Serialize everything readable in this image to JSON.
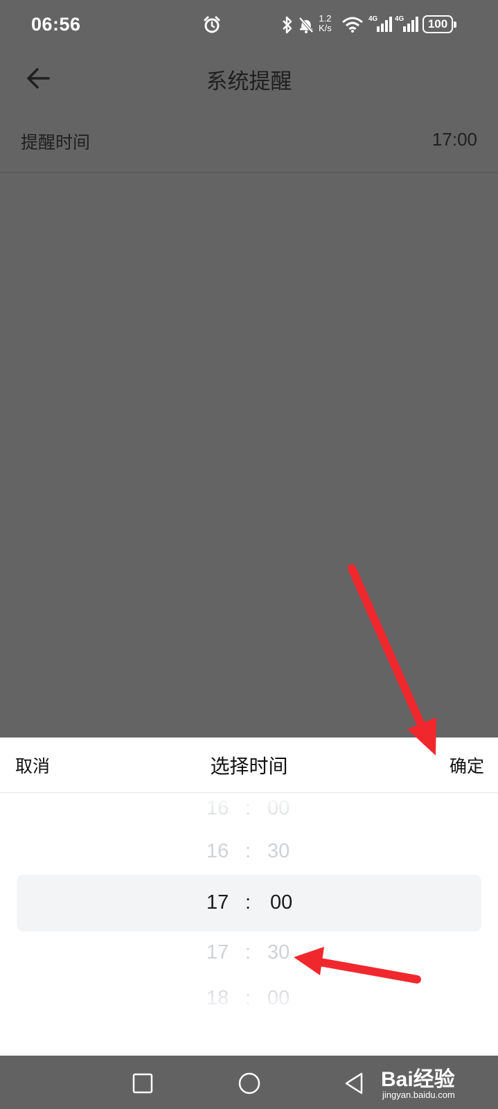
{
  "status_bar": {
    "time": "06:56",
    "net_speed_value": "1.2",
    "net_speed_unit": "K/s",
    "signal_1_label": "4G",
    "signal_2_label": "4G",
    "battery": "100",
    "icons": [
      "alarm-icon",
      "bluetooth-icon",
      "muted-bell-icon",
      "wifi-icon",
      "signal-icon",
      "battery-icon"
    ]
  },
  "header": {
    "title": "系统提醒"
  },
  "setting": {
    "label": "提醒时间",
    "value": "17:00"
  },
  "sheet": {
    "cancel_label": "取消",
    "title": "选择时间",
    "confirm_label": "确定"
  },
  "picker": {
    "separator": ":",
    "rows": [
      {
        "hour": "16",
        "minute": "00"
      },
      {
        "hour": "16",
        "minute": "30"
      },
      {
        "hour": "17",
        "minute": "00"
      },
      {
        "hour": "17",
        "minute": "30"
      },
      {
        "hour": "18",
        "minute": "00"
      }
    ],
    "selected_index": 2
  },
  "watermark": {
    "text": "Bai经验",
    "sub": "jingyan.baidu.com"
  },
  "colors": {
    "overlay": "#646464",
    "annotation_arrow": "#f0282d",
    "highlight_band": "#f3f4f6"
  }
}
